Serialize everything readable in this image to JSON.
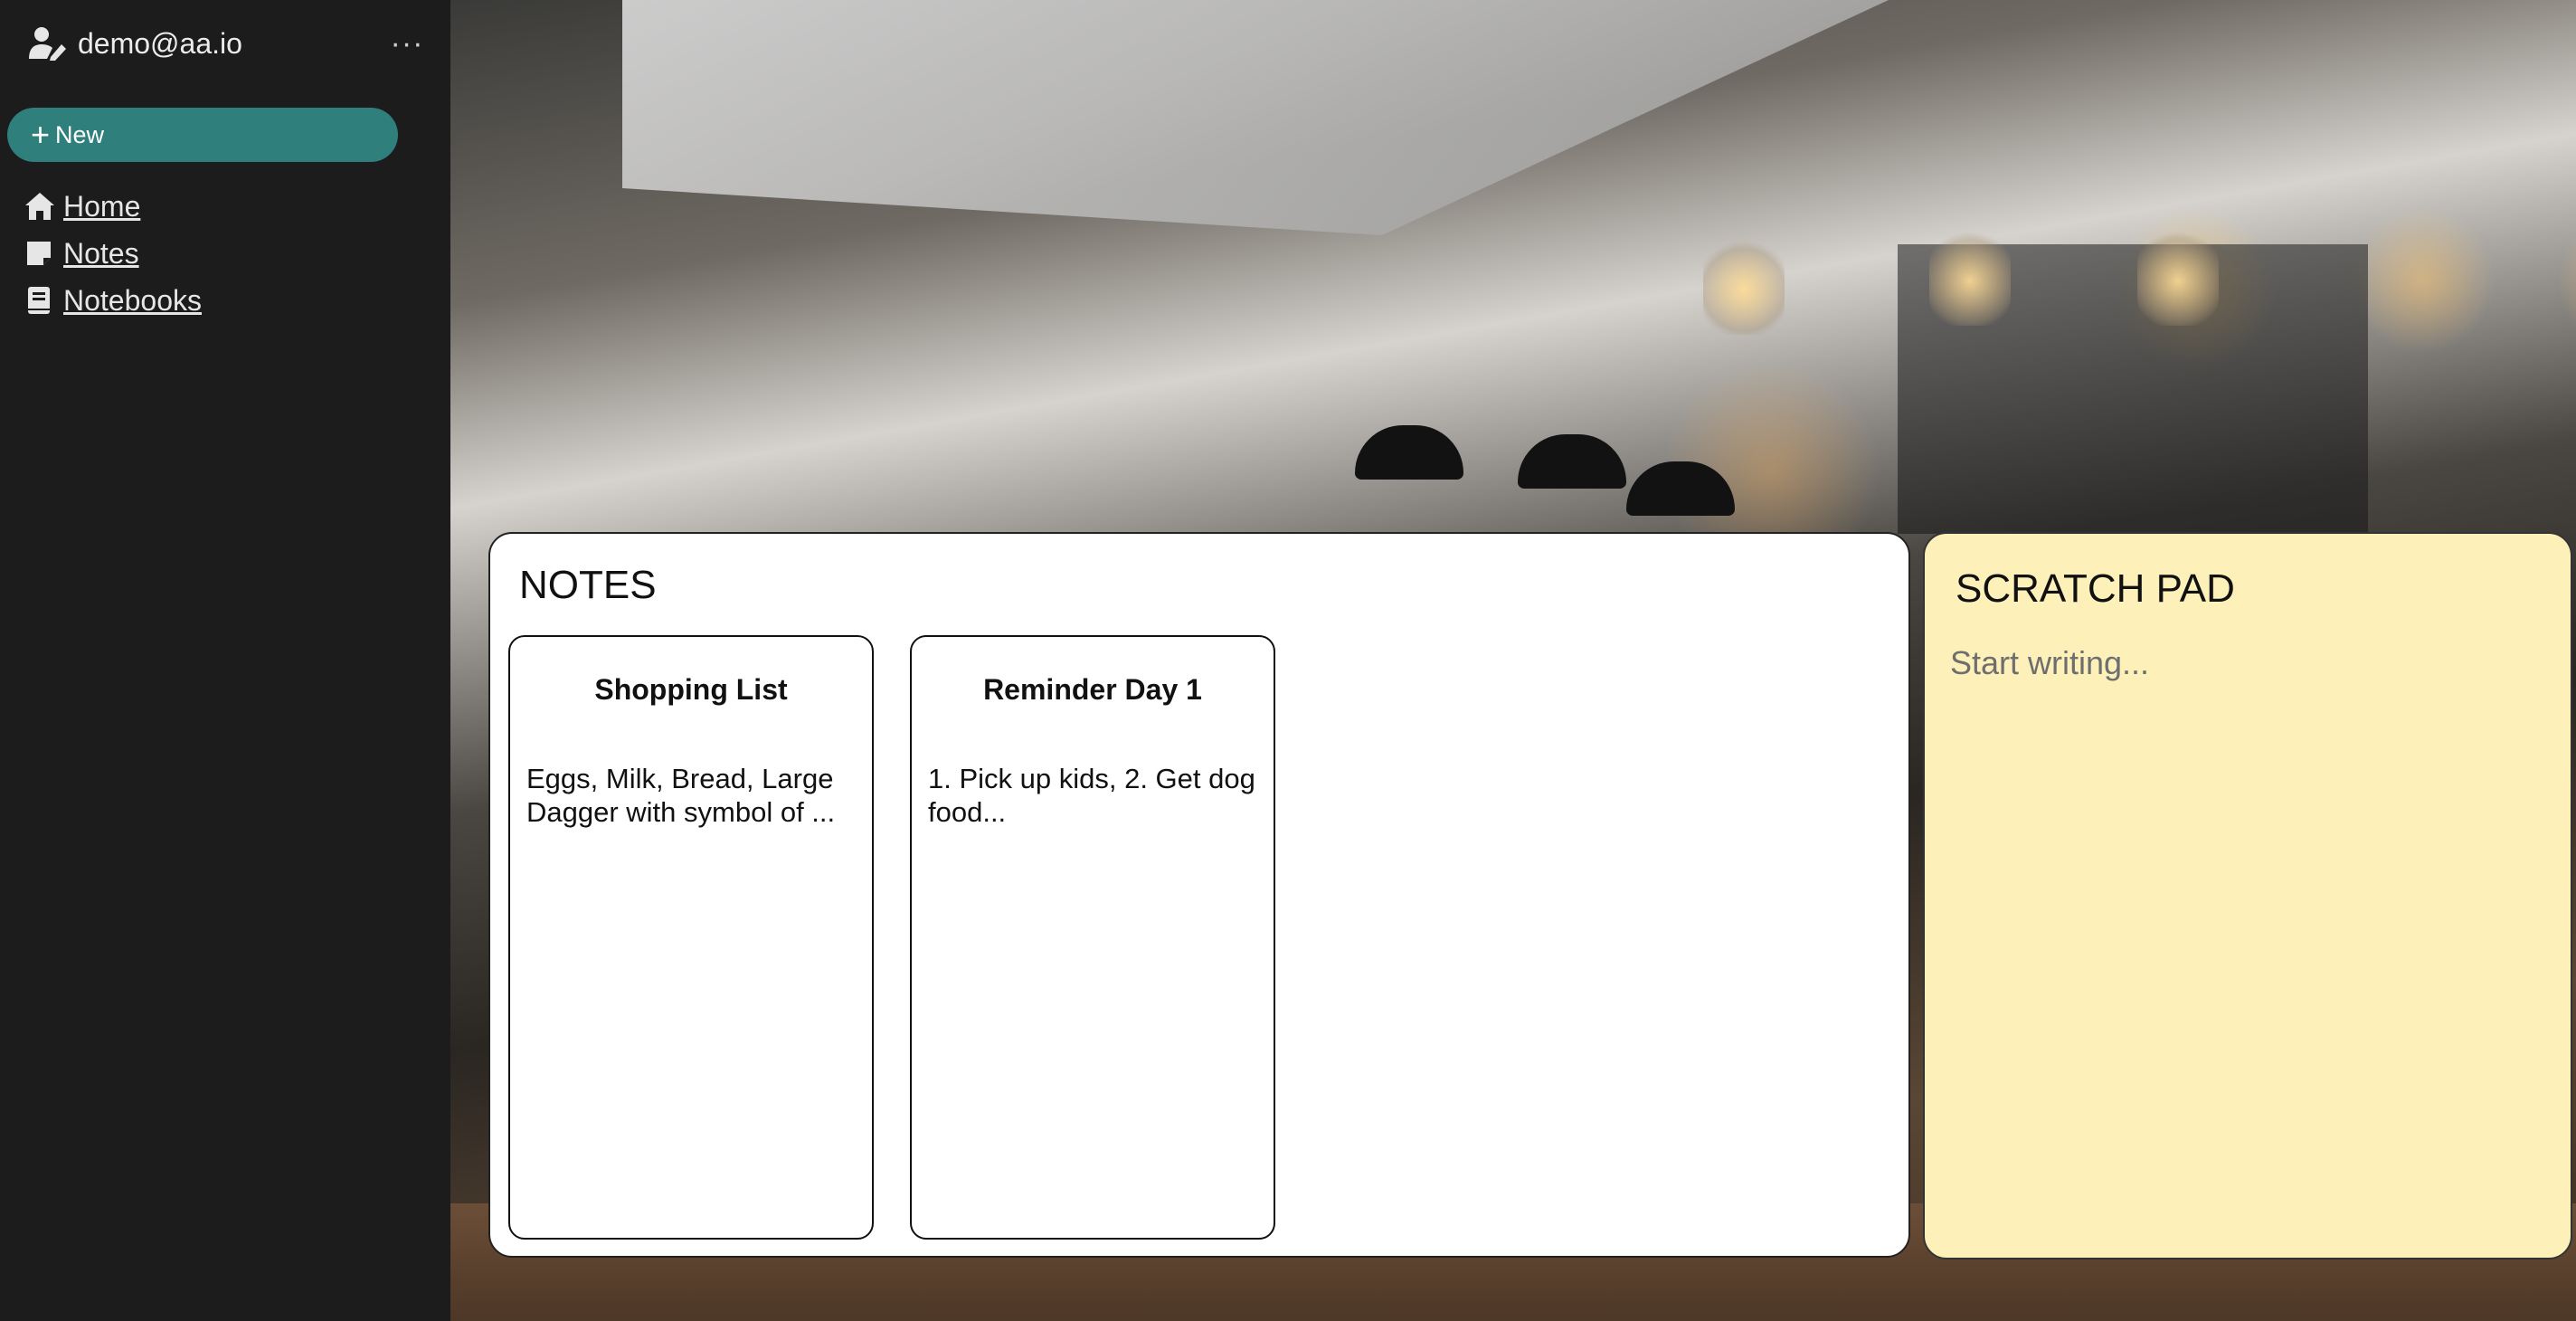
{
  "sidebar": {
    "user_email": "demo@aa.io",
    "more_label": "···",
    "new_button_label": "New",
    "nav": [
      {
        "label": " Home",
        "icon": "home-icon"
      },
      {
        "label": " Notes",
        "icon": "note-icon"
      },
      {
        "label": " Notebooks",
        "icon": "book-icon"
      }
    ]
  },
  "notes": {
    "title": "NOTES",
    "items": [
      {
        "title": "Shopping List",
        "preview": "Eggs, Milk, Bread, Large Dagger with symbol of ..."
      },
      {
        "title": "Reminder Day 1",
        "preview": "1. Pick up kids, 2. Get dog food..."
      }
    ]
  },
  "scratch_pad": {
    "title": "SCRATCH PAD",
    "placeholder": "Start writing..."
  },
  "colors": {
    "sidebar_bg": "#1c1c1c",
    "accent": "#2f7f7c",
    "scratch_bg": "#fdf0b8"
  }
}
